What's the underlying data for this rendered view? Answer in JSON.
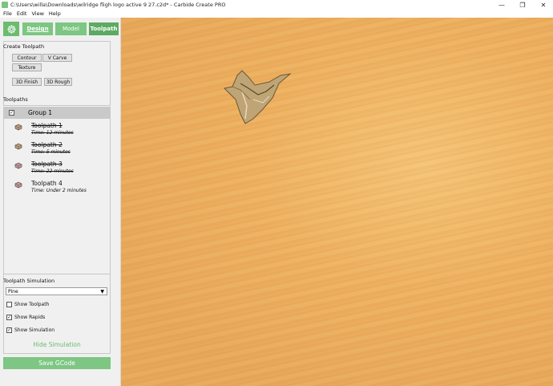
{
  "window": {
    "title": "C:\\Users\\willa\\Downloads\\wilridge fligh logo active 9 27.c2d* - Carbide Create PRO",
    "minimize": "—",
    "maximize": "❐",
    "close": "✕"
  },
  "menu": [
    "File",
    "Edit",
    "View",
    "Help"
  ],
  "nav": {
    "design": "Design",
    "model": "Model",
    "toolpath": "Toolpath",
    "active": "Toolpath"
  },
  "create_toolpath": {
    "title": "Create Toolpath",
    "contour": "Contour",
    "vcarve": "V Carve",
    "texture": "Texture",
    "finish3d": "3D Finish",
    "rough3d": "3D Rough"
  },
  "toolpaths": {
    "title": "Toolpaths",
    "group": {
      "name": "Group 1",
      "checked": "✓"
    },
    "items": [
      {
        "name": "Toolpath 1",
        "time": "Time: 12 minutes",
        "disabled": true
      },
      {
        "name": "Toolpath 2",
        "time": "Time: 5 minutes",
        "disabled": true
      },
      {
        "name": "Toolpath 3",
        "time": "Time: 22 minutes",
        "disabled": true
      },
      {
        "name": "Toolpath 4",
        "time": "Time: Under 2 minutes",
        "disabled": false
      }
    ]
  },
  "simulation": {
    "title": "Toolpath Simulation",
    "material": "Pine",
    "show_toolpath": {
      "label": "Show Toolpath",
      "check": ""
    },
    "show_rapids": {
      "label": "Show Rapids",
      "check": "✓"
    },
    "show_simulation": {
      "label": "Show Simulation",
      "check": "✓"
    },
    "hide_label": "Hide Simulation"
  },
  "save_gcode": "Save GCode",
  "colors": {
    "accent_green": "#7dc683",
    "active_tab": "#5daa62",
    "wood": "#eeb562"
  }
}
